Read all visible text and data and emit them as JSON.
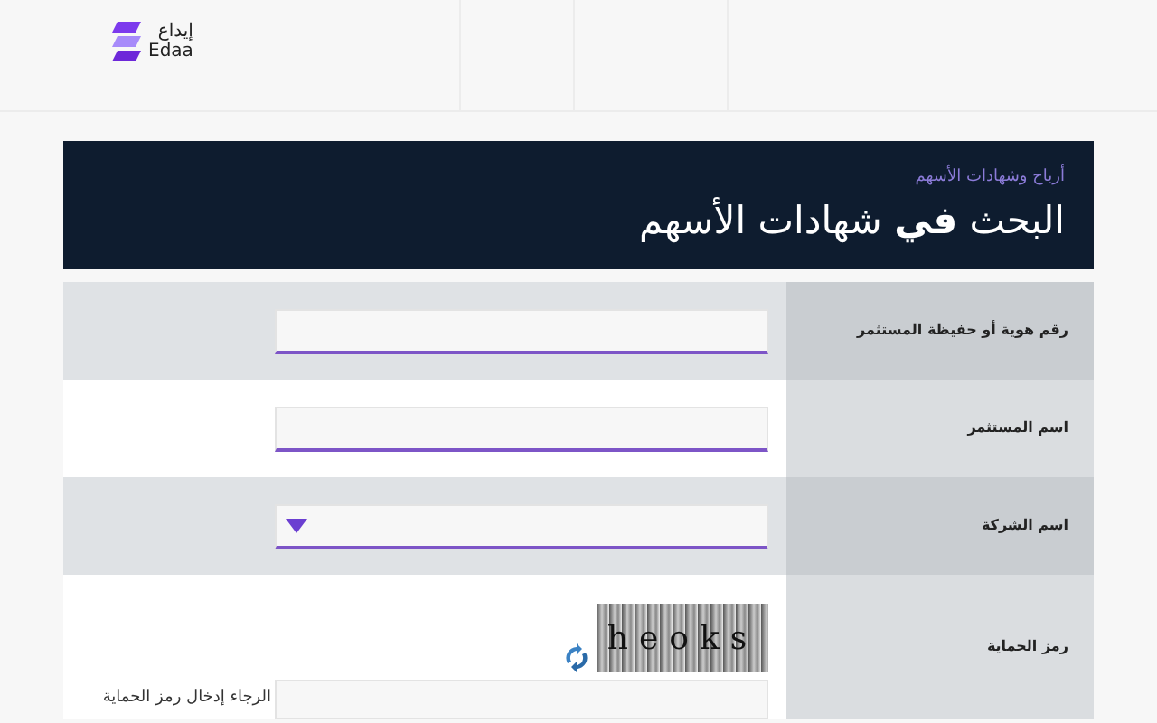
{
  "logo": {
    "arabic": "إيداع",
    "latin": "Edaa"
  },
  "banner": {
    "breadcrumb": "أرباح وشهادات الأسهم",
    "title": "البحث **في** شهادات الأسهم"
  },
  "form": {
    "rows": [
      {
        "kind": "text",
        "label": "رقم هوية أو حفيظة المستثمر"
      },
      {
        "kind": "text",
        "label": "اسم المستثمر"
      },
      {
        "kind": "select",
        "label": "اسم الشركة"
      },
      {
        "kind": "captcha",
        "label": "رمز الحماية",
        "captcha": "heoks",
        "hint": "الرجاء إدخال رمز الحماية"
      }
    ]
  }
}
